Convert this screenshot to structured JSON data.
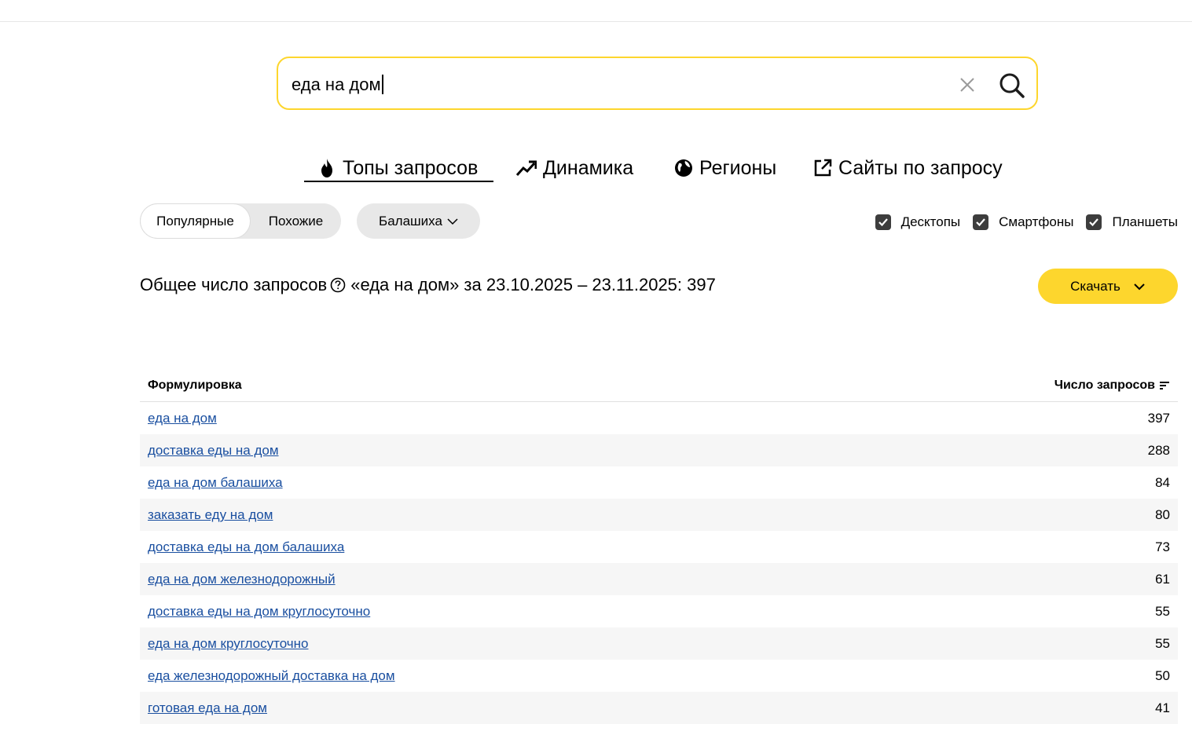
{
  "search": {
    "value": "еда на дом"
  },
  "tabs": [
    {
      "label": "Топы запросов",
      "icon": "fire-icon",
      "active": true
    },
    {
      "label": "Динамика",
      "icon": "trend-icon",
      "active": false
    },
    {
      "label": "Регионы",
      "icon": "globe-icon",
      "active": false
    },
    {
      "label": "Сайты по запросу",
      "icon": "external-link-icon",
      "active": false
    }
  ],
  "filters": {
    "popular": "Популярные",
    "similar": "Похожие",
    "region": "Балашиха",
    "devices": [
      {
        "label": "Десктопы",
        "checked": true
      },
      {
        "label": "Смартфоны",
        "checked": true
      },
      {
        "label": "Планшеты",
        "checked": true
      }
    ]
  },
  "summary": {
    "label": "Общее число запросов",
    "rest": "«еда на дом» за 23.10.2025 – 23.11.2025: 397"
  },
  "download_label": "Скачать",
  "table": {
    "col_phrase": "Формулировка",
    "col_count": "Число запросов",
    "rows": [
      {
        "phrase": "еда на дом",
        "count": "397"
      },
      {
        "phrase": "доставка еды на дом",
        "count": "288"
      },
      {
        "phrase": "еда на дом балашиха",
        "count": "84"
      },
      {
        "phrase": "заказать еду на дом",
        "count": "80"
      },
      {
        "phrase": "доставка еды на дом балашиха",
        "count": "73"
      },
      {
        "phrase": "еда на дом железнодорожный",
        "count": "61"
      },
      {
        "phrase": "доставка еды на дом круглосуточно",
        "count": "55"
      },
      {
        "phrase": "еда на дом круглосуточно",
        "count": "55"
      },
      {
        "phrase": "еда железнодорожный доставка на дом",
        "count": "50"
      },
      {
        "phrase": "готовая еда на дом",
        "count": "41"
      }
    ]
  },
  "colors": {
    "accent": "#fdd62d",
    "link": "#1a4fa0",
    "checkbox": "#3d3d3d"
  }
}
